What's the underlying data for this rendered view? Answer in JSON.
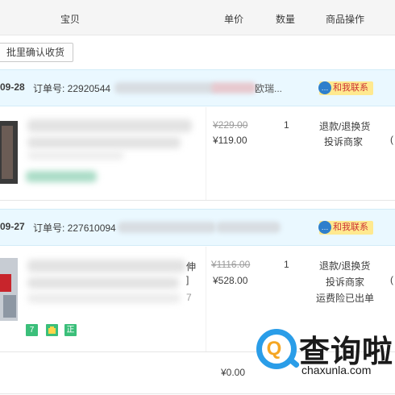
{
  "header": {
    "item_col": "宝贝",
    "price_col": "单价",
    "qty_col": "数量",
    "ops_col": "商品操作"
  },
  "bulk_confirm_label": "批里确认收货",
  "orders": [
    {
      "date": "09-28",
      "order_no": "订单号: 22920544",
      "shop_suffix": "欧瑞...",
      "contact_label": "和我联系",
      "price_original": "¥229.00",
      "price_now": "¥119.00",
      "qty": "1",
      "ops": [
        "退款/退换货",
        "投诉商家"
      ]
    },
    {
      "date": "09-27",
      "order_no": "订单号: 227610094",
      "shop_suffix": "",
      "contact_label": "和我联系",
      "price_original": "¥1116.00",
      "price_now": "¥528.00",
      "qty": "1",
      "item_fragments": [
        "伸",
        "]",
        "7"
      ],
      "ops": [
        "退款/退换货",
        "投诉商家",
        "运费险已出单"
      ],
      "tags": [
        "7",
        "正"
      ]
    }
  ],
  "extra_row_price": "¥0.00",
  "right_edge_glyphs": [
    "(",
    "("
  ],
  "watermark": {
    "title": "查询啦",
    "url": "chaxunla.com"
  },
  "colors": {
    "order_header_bg": "#eaf8ff",
    "contact_bg": "#ffe98f",
    "contact_text": "#cc3333",
    "tag_green": "#3bbf7a",
    "watermark_blue": "#2a9de8",
    "watermark_orange": "#f5a623"
  }
}
